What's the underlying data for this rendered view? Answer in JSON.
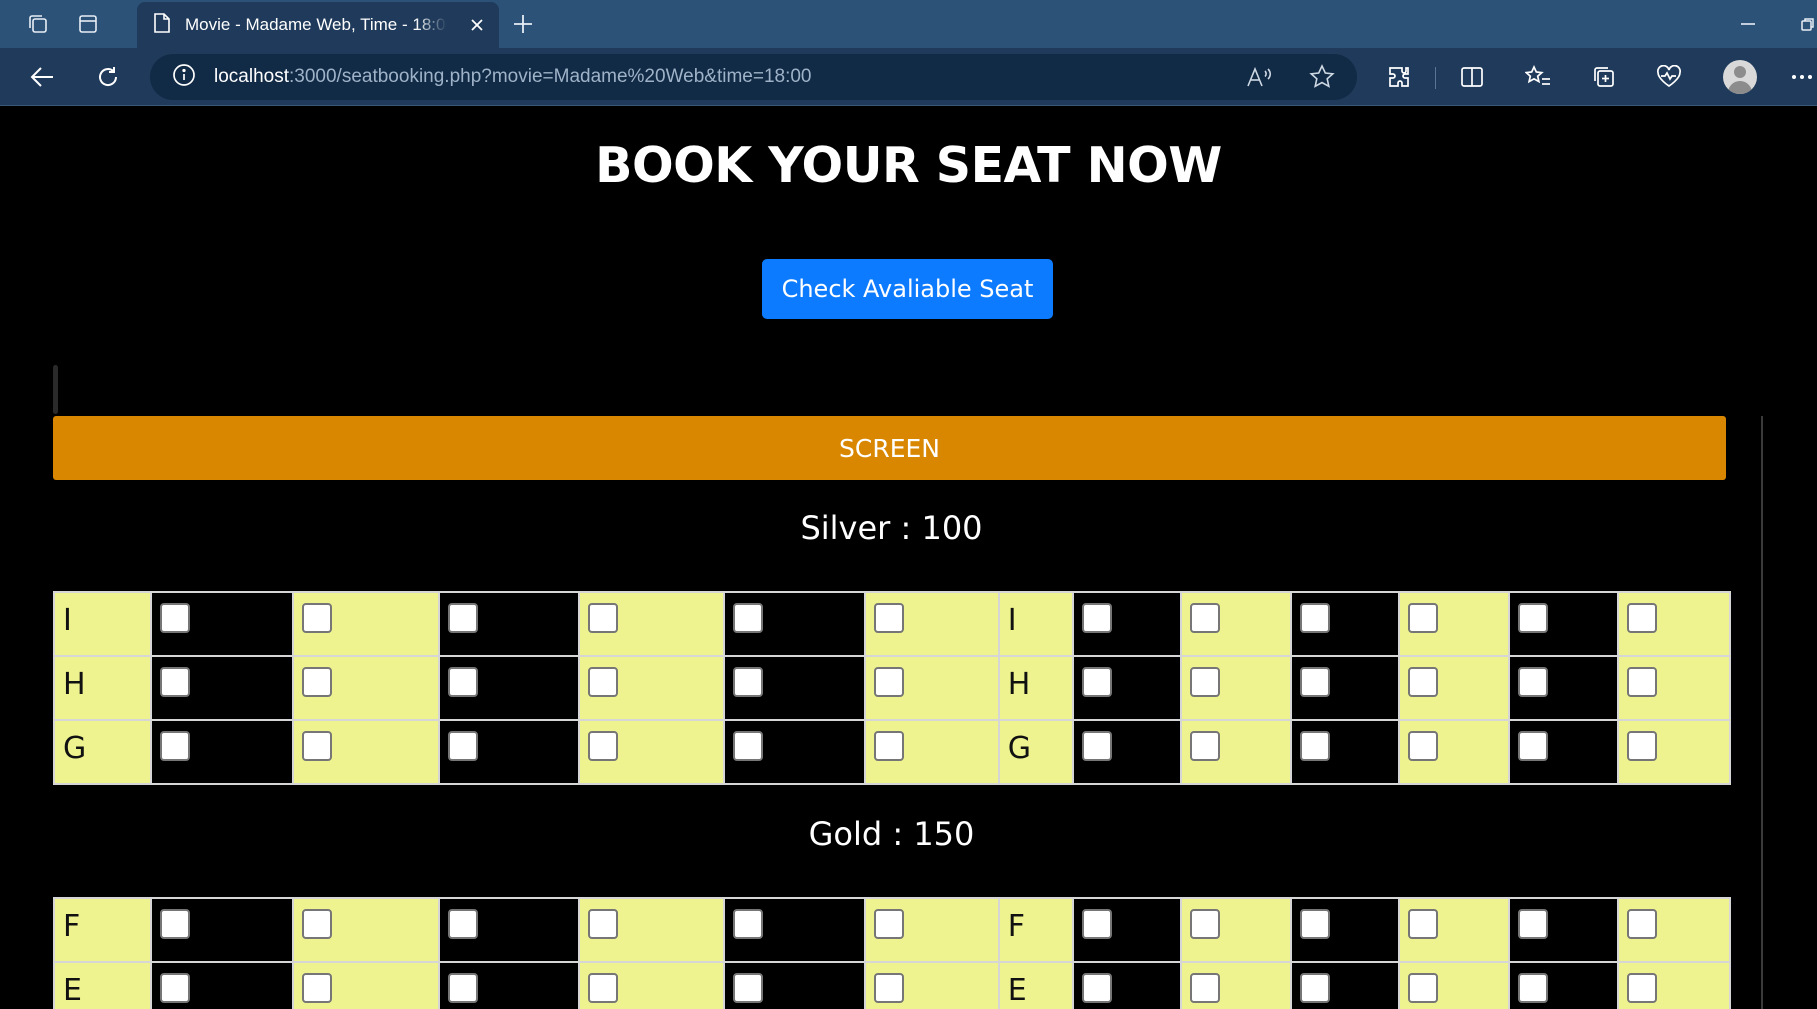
{
  "browser": {
    "tab_title": "Movie - Madame Web, Time - 18:00",
    "url_host": "localhost",
    "url_rest": ":3000/seatbooking.php?movie=Madame%20Web&time=18:00"
  },
  "page": {
    "heading": "BOOK YOUR SEAT NOW",
    "check_button": "Check Avaliable Seat",
    "screen_label": "SCREEN"
  },
  "sections": [
    {
      "label": "Silver : 100",
      "rows": [
        "I",
        "H",
        "G"
      ]
    },
    {
      "label": "Gold : 150",
      "rows": [
        "F",
        "E"
      ]
    }
  ],
  "colors": {
    "chrome_tabbar": "#2c5277",
    "chrome_toolbar": "#1f3a5a",
    "button_blue": "#0d7bff",
    "screen_orange": "#d98700",
    "seat_yellow": "#eef390",
    "seat_black": "#000000"
  }
}
